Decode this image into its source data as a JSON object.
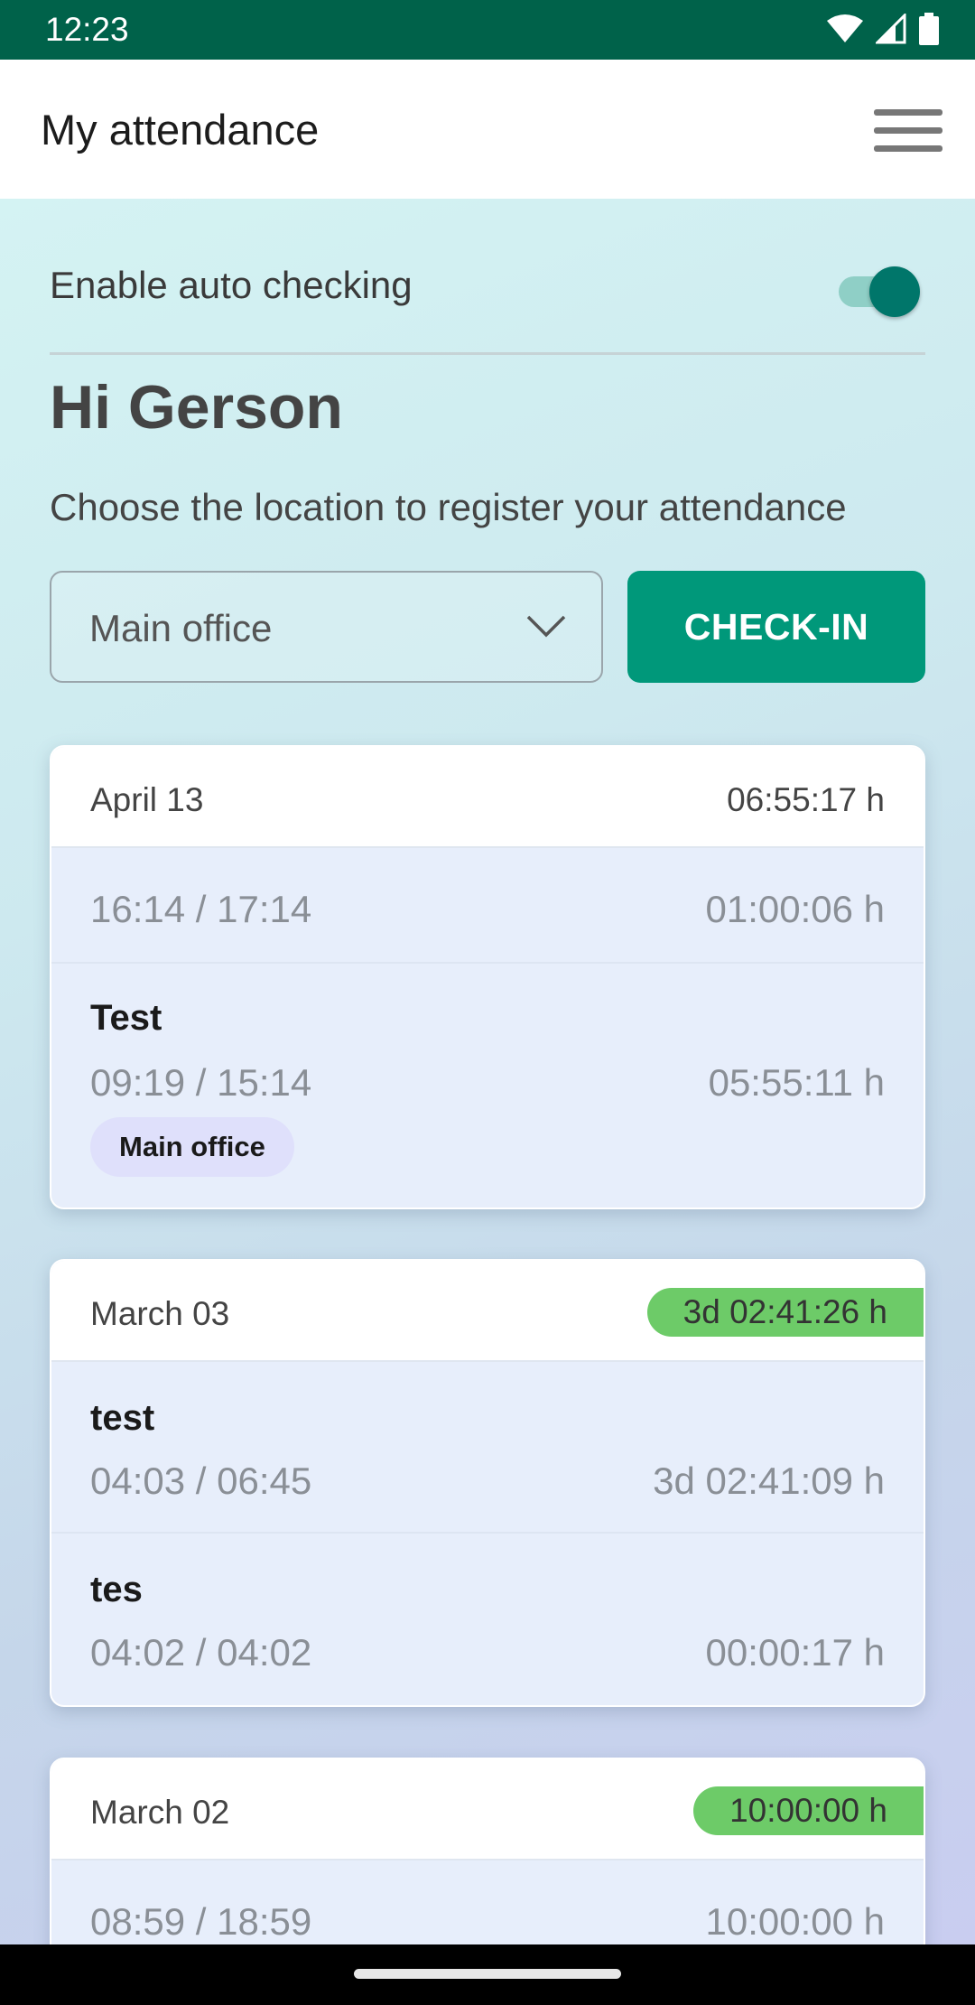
{
  "status_bar": {
    "time": "12:23"
  },
  "app_bar": {
    "title": "My attendance"
  },
  "auto_check": {
    "label": "Enable auto checking",
    "enabled": true
  },
  "greeting": "Hi Gerson",
  "prompt": "Choose the location to register your attendance",
  "location_select": {
    "value": "Main office"
  },
  "checkin_button": "CHECK-IN",
  "colors": {
    "primary": "#00987a",
    "status_bar": "#00624a",
    "badge_green": "#6dcb68",
    "chip": "#dfe0fb"
  },
  "days": [
    {
      "date": "April 13",
      "total": "06:55:17 h",
      "total_highlighted": false,
      "entries": [
        {
          "name": "",
          "times": "16:14 / 17:14",
          "duration": "01:00:06 h",
          "location": ""
        },
        {
          "name": "Test",
          "times": "09:19 / 15:14",
          "duration": "05:55:11 h",
          "location": "Main office"
        }
      ]
    },
    {
      "date": "March 03",
      "total": "3d 02:41:26 h",
      "total_highlighted": true,
      "entries": [
        {
          "name": "test",
          "times": "04:03 / 06:45",
          "duration": "3d 02:41:09 h",
          "location": ""
        },
        {
          "name": "tes",
          "times": "04:02 / 04:02",
          "duration": "00:00:17 h",
          "location": ""
        }
      ]
    },
    {
      "date": "March 02",
      "total": "10:00:00 h",
      "total_highlighted": true,
      "entries": [
        {
          "name": "",
          "times": "08:59 / 18:59",
          "duration": "10:00:00 h",
          "location": ""
        }
      ]
    }
  ]
}
